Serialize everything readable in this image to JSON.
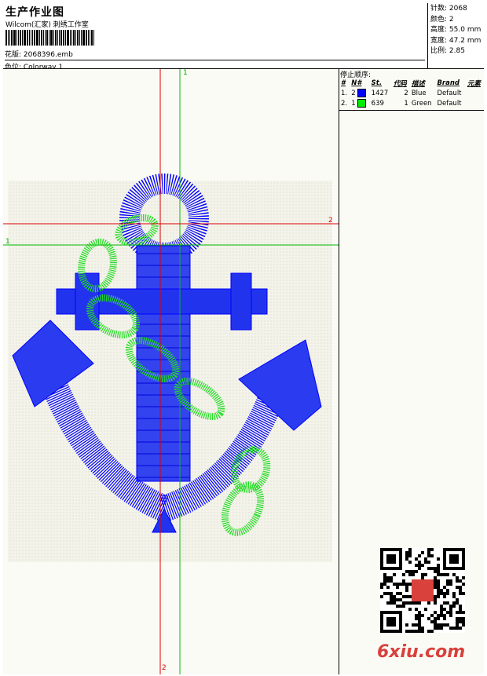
{
  "header": {
    "title": "生产作业图",
    "subtitle": "Wilcom(汇家) 刺绣工作室",
    "file_label": "花版: 2068396.emb",
    "colorway_label": "色位: Colorway 1"
  },
  "stats": [
    {
      "label": "针数:",
      "value": "2068"
    },
    {
      "label": "颜色:",
      "value": "2"
    },
    {
      "label": "高度:",
      "value": "55.0 mm"
    },
    {
      "label": "宽度:",
      "value": "47.2 mm"
    },
    {
      "label": "比例:",
      "value": "2.85"
    }
  ],
  "stop_sequence": {
    "title": "停止顺序:",
    "columns": [
      "#",
      "N#",
      "St.",
      "代码",
      "描述",
      "Brand",
      "元素"
    ],
    "rows": [
      {
        "idx": "1.",
        "n": "2",
        "color": "#0000ff",
        "st": "1427",
        "code": "2",
        "desc": "Blue",
        "brand": "Default",
        "element": ""
      },
      {
        "idx": "2.",
        "n": "1",
        "color": "#00ee00",
        "st": "639",
        "code": "1",
        "desc": "Green",
        "brand": "Default",
        "element": ""
      }
    ]
  },
  "axes": {
    "vertical_green_top": "1",
    "horizontal_red_right": "2",
    "horizontal_green_left": "1",
    "vertical_red_bottom": "2"
  },
  "colors": {
    "blue_thread": "#0000ff",
    "green_thread": "#22dd22",
    "red_axis": "#dd0000",
    "green_axis": "#00bb00"
  },
  "watermark": "6xiu.com"
}
